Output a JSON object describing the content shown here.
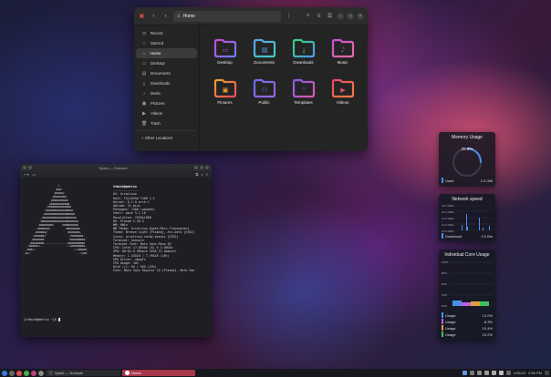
{
  "files": {
    "location": "Home",
    "sidebar": [
      {
        "label": "Recent",
        "icon": "clock-icon",
        "glyph": "◷"
      },
      {
        "label": "Starred",
        "icon": "star-icon",
        "glyph": "☆"
      },
      {
        "label": "Home",
        "icon": "home-icon",
        "glyph": "⌂"
      },
      {
        "label": "Desktop",
        "icon": "desktop-icon",
        "glyph": "▭"
      },
      {
        "label": "Documents",
        "icon": "document-icon",
        "glyph": "▤"
      },
      {
        "label": "Downloads",
        "icon": "download-icon",
        "glyph": "⤓"
      },
      {
        "label": "Music",
        "icon": "music-icon",
        "glyph": "♪"
      },
      {
        "label": "Pictures",
        "icon": "picture-icon",
        "glyph": "▣"
      },
      {
        "label": "Videos",
        "icon": "video-icon",
        "glyph": "▶"
      },
      {
        "label": "Trash",
        "icon": "trash-icon",
        "glyph": "🗑"
      }
    ],
    "other_locations": "+ Other Locations",
    "folders": [
      {
        "label": "Desktop",
        "c1": "#c84bd8",
        "c2": "#6a7cf5",
        "glyph": "▭"
      },
      {
        "label": "Documents",
        "c1": "#5aa0f0",
        "c2": "#3fd0c0",
        "glyph": "▤"
      },
      {
        "label": "Downloads",
        "c1": "#3cd07a",
        "c2": "#4a9af0",
        "glyph": "⤓"
      },
      {
        "label": "Music",
        "c1": "#c850d8",
        "c2": "#e86aa0",
        "glyph": "♪"
      },
      {
        "label": "Pictures",
        "c1": "#f0a030",
        "c2": "#e84a5a",
        "glyph": "▣"
      },
      {
        "label": "Public",
        "c1": "#6a70f0",
        "c2": "#a060e0",
        "glyph": "⚇"
      },
      {
        "label": "Templates",
        "c1": "#8a5ae8",
        "c2": "#d85ab0",
        "glyph": "⌃"
      },
      {
        "label": "Videos",
        "c1": "#e84a6a",
        "c2": "#f08040",
        "glyph": "▶"
      }
    ]
  },
  "terminal": {
    "title": "Spark — Konsole",
    "username": "tfmich@metrix",
    "info": [
      "OS: ArcoLinux",
      "Host: ThinkPad T480 1.2",
      "Kernel: 6.1.8-arch-1",
      "Uptime: 21 mins",
      "Packages: 1300 (pacman)",
      "Shell: bash 5.1.16",
      "Resolution: 1920x1080",
      "DE: Plasma 5.26.5",
      "WM: KWin",
      "WM Theme: ArcoLinux-Sweet-Mars-Transparent",
      "Theme: Breeze Light [Plasma], Arc-Dark [GTK2]",
      "Icons: arcolinux-candy-beauty [GTK2]",
      "Terminal: konsole",
      "Terminal Font: Noto Sans Mono 10",
      "CPU: Intel i7-8550U (8) @ 2.50GHz",
      "GPU: 00:02.0 VMware SVGA II Adapter",
      "Memory: 1.43GiB / 7.76GiB (18%)",
      "GPU Driver: vmwgfx",
      "CPU Usage: 10%",
      "Disk (/): 8G / 95G (10%)",
      "Font: Noto Sans Regular 10 [Plasma], Noto San"
    ],
    "prompt": "[tfmich@metrix ~]$ "
  },
  "widgets": {
    "memory": {
      "title": "Memory Usage",
      "percent": 25.6,
      "percent_label": "25.6%",
      "used_label": "Used",
      "used_value": "2.0 GiB",
      "color": "#4a8fe8"
    },
    "network": {
      "title": "Network speed",
      "y_labels": [
        "18.0 KiB/s",
        "16.0 KiB/s",
        "14.0 KiB/s",
        "12.0 KiB/s",
        "10.0 KiB/s"
      ],
      "download_label": "Download",
      "download_value": "0.0 B/s",
      "color": "#4a8fe8"
    },
    "cores": {
      "title": "Individual Core Usage",
      "y_labels": [
        "100%",
        "80%",
        "60%",
        "40%",
        "20%"
      ],
      "rows": [
        {
          "label": "Usage",
          "value": "12.0%",
          "color": "#4a8fe8"
        },
        {
          "label": "Usage",
          "value": "8.3%",
          "color": "#c060e0"
        },
        {
          "label": "Usage",
          "value": "10.4%",
          "color": "#e0a040"
        },
        {
          "label": "Usage",
          "value": "10.2%",
          "color": "#40c060"
        }
      ]
    }
  },
  "taskbar": {
    "terminal_task": "Spark — Konsole",
    "files_task": "Home",
    "time": "2:56 PM",
    "date": "1/26/23"
  }
}
